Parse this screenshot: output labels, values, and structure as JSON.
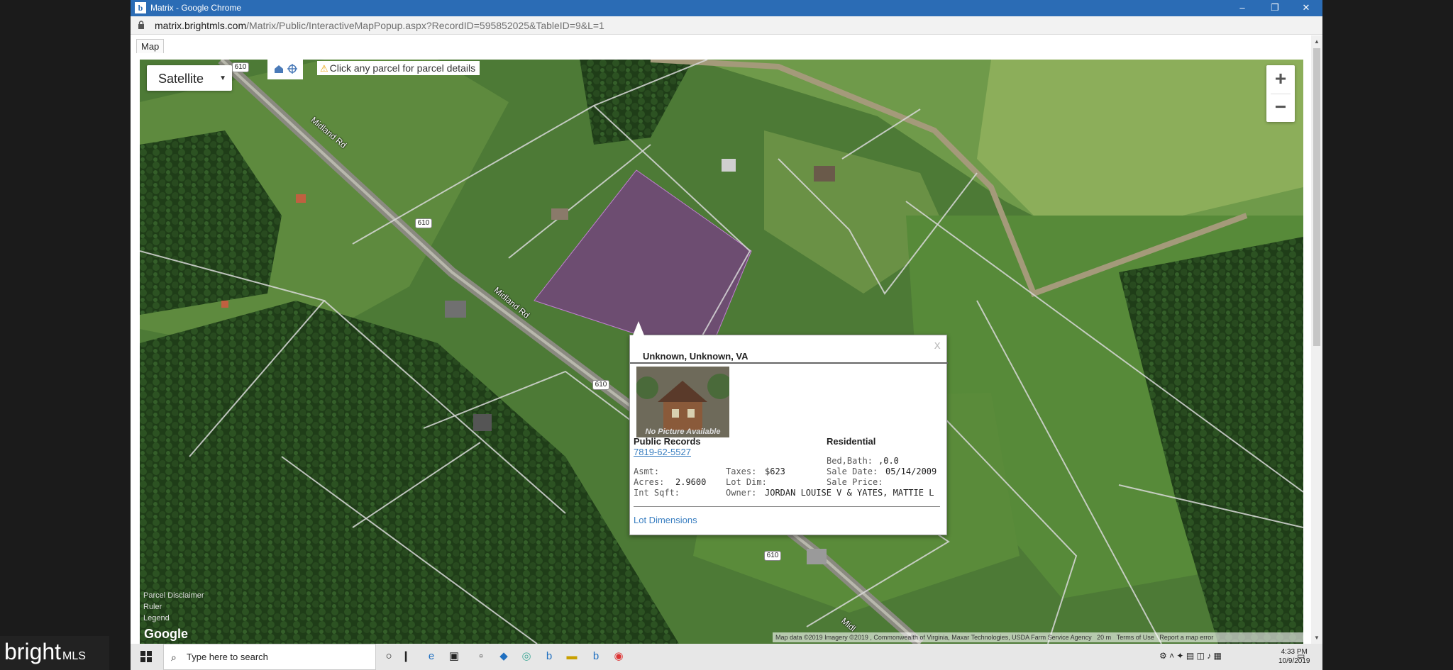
{
  "window": {
    "title": "Matrix - Google Chrome",
    "controls": {
      "minimize": "‒",
      "maximize": "❐",
      "close": "✕"
    }
  },
  "address_bar": {
    "host": "matrix.brightmls.com",
    "path": "/Matrix/Public/InteractiveMapPopup.aspx?RecordID=595852025&TableID=9&L=1"
  },
  "tab": {
    "label": "Map"
  },
  "map": {
    "map_type": "Satellite",
    "hint": "Click any parcel for parcel details",
    "zoom_in": "+",
    "zoom_out": "−",
    "roads": {
      "midland_rd": "Midland Rd",
      "midland_rd_partial": "Midl",
      "route": "610"
    },
    "legend": {
      "parcel_disclaimer": "Parcel Disclaimer",
      "ruler": "Ruler",
      "legend": "Legend"
    },
    "google": "Google",
    "attribution": {
      "data": "Map data ©2019 Imagery ©2019 , Commonwealth of Virginia, Maxar Technologies, USDA Farm Service Agency",
      "scale": "20 m",
      "terms": "Terms of Use",
      "report": "Report a map error"
    },
    "accent_color": "#7a3a8a"
  },
  "popup": {
    "address": "Unknown, Unknown, VA",
    "photo_text": "No Picture Available",
    "section": "Public Records",
    "parcel_id": "7819-62-5527",
    "property_type": "Residential",
    "asmt_label": "Asmt:",
    "asmt_value": "",
    "acres_label": "Acres:",
    "acres_value": "2.9600",
    "int_sqft_label": "Int Sqft:",
    "int_sqft_value": "",
    "taxes_label": "Taxes:",
    "taxes_value": "$623",
    "lot_dim_label": "Lot Dim:",
    "lot_dim_value": "",
    "owner_label": "Owner:",
    "owner_value": "JORDAN LOUISE V & YATES, MATTIE L",
    "bed_bath_label": "Bed,Bath:",
    "bed_bath_value": ",0.0",
    "sale_date_label": "Sale Date:",
    "sale_date_value": "05/14/2009",
    "sale_price_label": "Sale Price:",
    "sale_price_value": "",
    "lot_dimensions_link": "Lot Dimensions",
    "close": "x"
  },
  "watermark": {
    "brand": "bright",
    "suffix": "MLS"
  },
  "taskbar": {
    "search_placeholder": "Type here to search",
    "time": "4:33 PM",
    "date": "10/9/2019"
  }
}
